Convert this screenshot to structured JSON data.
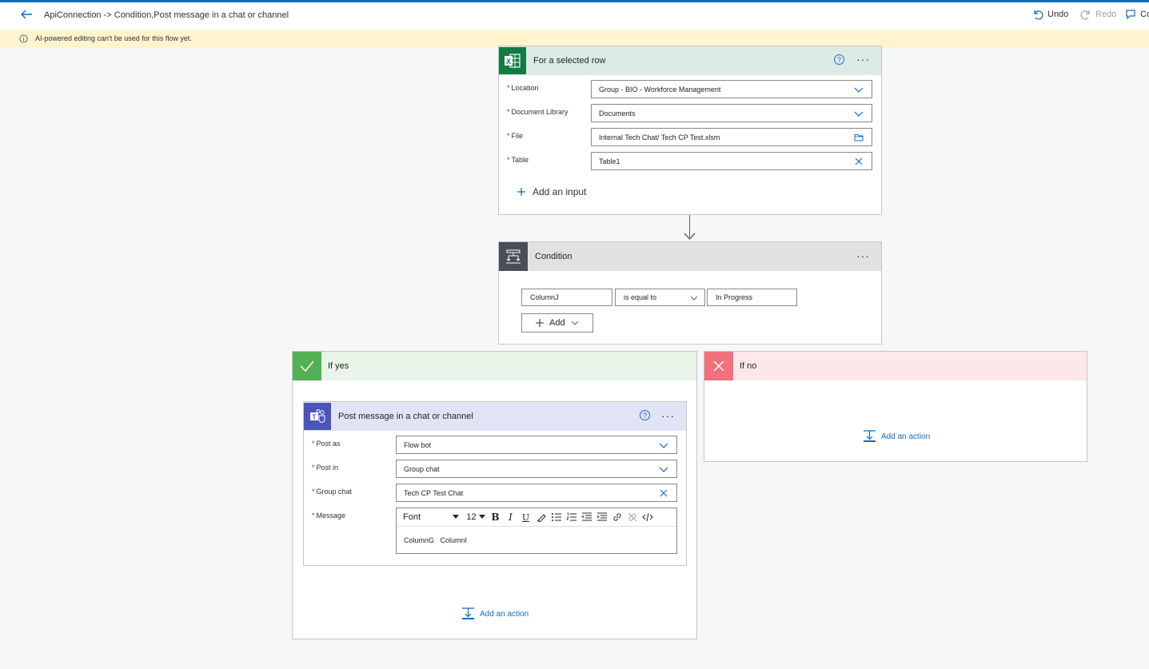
{
  "header": {
    "title": "ApiConnection -> Condition,Post message in a chat or channel",
    "undo_label": "Undo",
    "redo_label": "Redo",
    "comments_label": "Co"
  },
  "banner": {
    "text": "AI-powered editing can't be used for this flow yet."
  },
  "excel_card": {
    "title": "For a selected row",
    "fields": [
      {
        "label": "Location",
        "value": "Group - BIO - Workforce Management",
        "icon": "chevron-down-icon"
      },
      {
        "label": "Document Library",
        "value": "Documents",
        "icon": "chevron-down-icon"
      },
      {
        "label": "File",
        "value": "Internal Tech Chat/ Tech CP Test.xlsm",
        "icon": "folder-icon"
      },
      {
        "label": "Table",
        "value": "Table1",
        "icon": "clear-icon"
      }
    ],
    "add_input_label": "Add an input"
  },
  "condition_card": {
    "title": "Condition",
    "left_operand": "ColumnJ",
    "operator": "is equal to",
    "right_operand": "In Progress",
    "add_label": "Add"
  },
  "if_yes": {
    "title": "If yes",
    "add_action_label": "Add an action",
    "teams_card": {
      "title": "Post message in a chat or channel",
      "fields": [
        {
          "label": "Post as",
          "value": "Flow bot"
        },
        {
          "label": "Post in",
          "value": "Group chat"
        },
        {
          "label": "Group chat",
          "value": "Tech CP Test Chat"
        },
        {
          "label": "Message"
        }
      ],
      "editor": {
        "font_label": "Font",
        "size_label": "12",
        "content": "ColumnG   ColumnI"
      }
    }
  },
  "if_no": {
    "title": "If no",
    "add_action_label": "Add an action"
  },
  "colors": {
    "accent": "#0f6cbd",
    "excel_green": "#107c41",
    "teams_purple": "#4b53bc",
    "yes_green": "#54b054",
    "no_red": "#f1707b",
    "banner_yellow": "#fff4ce"
  }
}
